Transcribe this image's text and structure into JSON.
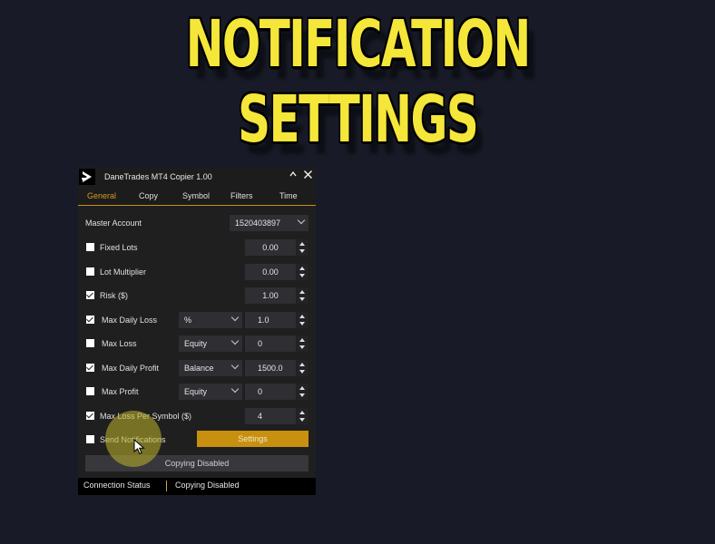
{
  "headline": "NOTIFICATION SETTINGS",
  "window": {
    "title": "DaneTrades MT4 Copier 1.00",
    "logo_icon": "play-chevron-logo",
    "controls": {
      "minimize": "^",
      "close": "×"
    }
  },
  "tabs": [
    {
      "label": "General",
      "active": true
    },
    {
      "label": "Copy",
      "active": false
    },
    {
      "label": "Symbol",
      "active": false
    },
    {
      "label": "Filters",
      "active": false
    },
    {
      "label": "Time",
      "active": false
    }
  ],
  "master_account": {
    "label": "Master Account",
    "value": "1520403897"
  },
  "rows": [
    {
      "label": "Fixed Lots",
      "checked": false,
      "mode": null,
      "value": "0.00"
    },
    {
      "label": "Lot Multiplier",
      "checked": false,
      "mode": null,
      "value": "0.00"
    },
    {
      "label": "Risk ($)",
      "checked": true,
      "mode": null,
      "value": "1.00"
    },
    {
      "label": "Max Daily Loss",
      "checked": true,
      "mode": "%",
      "value": "1.0"
    },
    {
      "label": "Max Loss",
      "checked": false,
      "mode": "Equity",
      "value": "0"
    },
    {
      "label": "Max Daily Profit",
      "checked": true,
      "mode": "Balance",
      "value": "1500.0"
    },
    {
      "label": "Max Profit",
      "checked": false,
      "mode": "Equity",
      "value": "0"
    },
    {
      "label": "Max Loss Per Symbol ($)",
      "checked": true,
      "mode": null,
      "value": "4"
    }
  ],
  "send_notifications": {
    "label": "Send Notifications",
    "checked": false
  },
  "settings_button": {
    "label": "Settings",
    "color": "#c8900f"
  },
  "copying_button": {
    "label": "Copying Disabled"
  },
  "status_bar": {
    "left": "Connection Status",
    "right": "Copying Disabled"
  },
  "colors": {
    "background": "#181b27",
    "headline": "#f5e63a",
    "accent": "#d49a28",
    "panel": "#1f1f1f"
  }
}
